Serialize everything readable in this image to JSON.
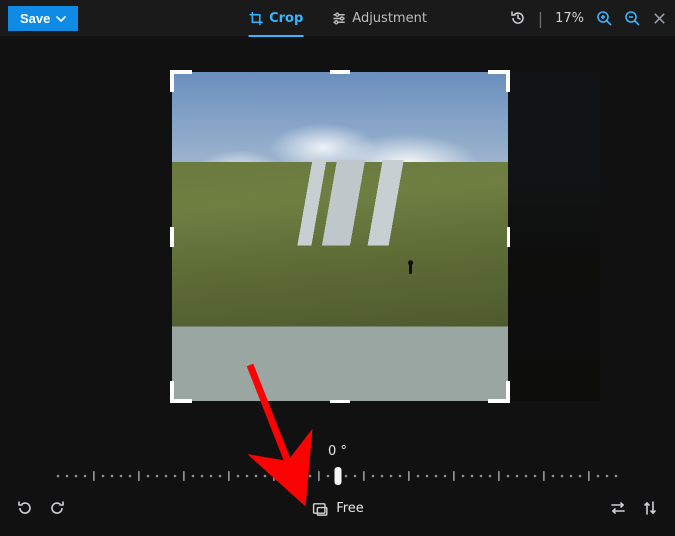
{
  "toolbar": {
    "save_label": "Save",
    "tabs": {
      "crop": "Crop",
      "adjustment": "Adjustment"
    },
    "zoom_text": "17%"
  },
  "rotation": {
    "readout": "0 °"
  },
  "aspect": {
    "label": "Free"
  }
}
